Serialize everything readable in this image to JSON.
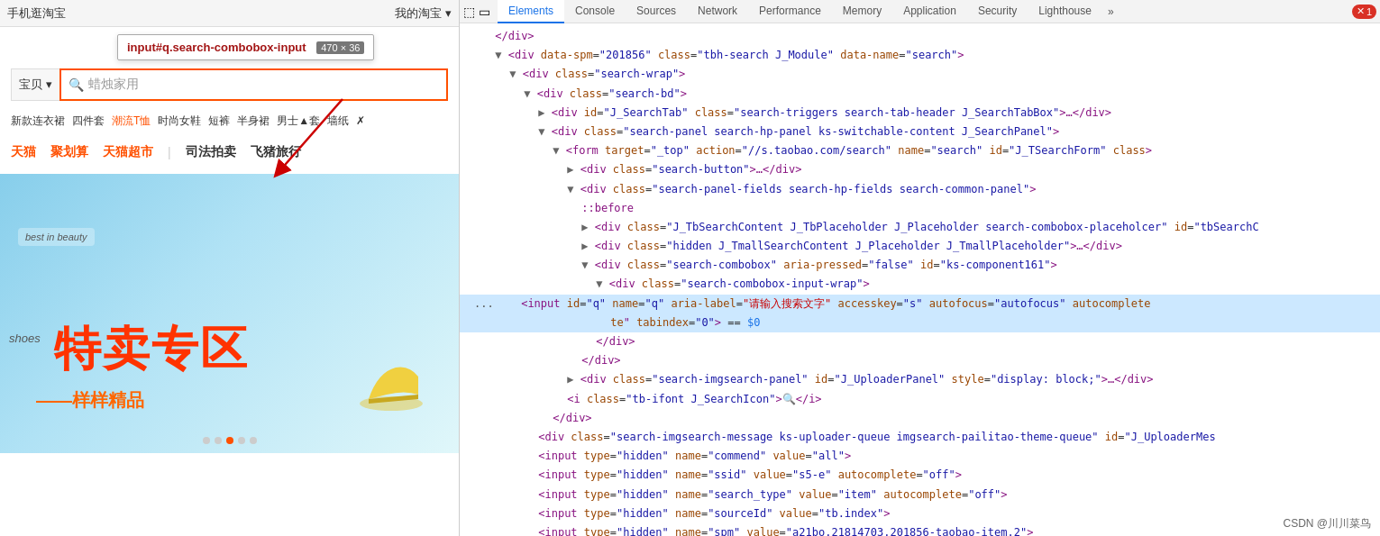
{
  "browser": {
    "top_nav": {
      "items": [
        "手机逛淘宝",
        "我的淘宝 ▾"
      ]
    },
    "tooltip": {
      "element": "input#q.search-combobox-input",
      "size": "470 × 36"
    },
    "search": {
      "category": "宝贝 ▾",
      "placeholder": "蜡烛家用",
      "icon": "🔍"
    },
    "tags": [
      "新款连衣裙",
      "四件套",
      "潮流T恤",
      "时尚女鞋",
      "短裤",
      "半身裙",
      "男士▲套",
      "墙纸",
      "✗"
    ],
    "cat_nav": [
      "天猫",
      "聚划算",
      "天猫超市",
      "|",
      "司法拍卖",
      "飞猪旅行"
    ],
    "banner": {
      "big_text": "特卖专▲",
      "sub_text": "样样精品",
      "best_label": "best in beauty",
      "shoes_label": "shoes"
    }
  },
  "devtools": {
    "tabs": [
      "Elements",
      "Console",
      "Sources",
      "Network",
      "Performance",
      "Memory",
      "Application",
      "Security",
      "Lighthouse"
    ],
    "active_tab": "Elements",
    "tab_icons": [
      "cursor-icon",
      "box-icon"
    ],
    "more_label": "»",
    "error_count": "1",
    "html": {
      "lines": [
        {
          "indent": 4,
          "content": "</div>",
          "type": "tag",
          "highlighted": false
        },
        {
          "indent": 4,
          "content": "<div data-spm=\"201856\" class=\"tbh-search J_Module\" data-name=\"search\">",
          "type": "tag",
          "highlighted": false
        },
        {
          "indent": 5,
          "content": "<div class=\"search-wrap\">",
          "type": "tag",
          "highlighted": false
        },
        {
          "indent": 6,
          "content": "<div class=\"search-bd\">",
          "type": "tag",
          "highlighted": false
        },
        {
          "indent": 7,
          "content": "<div id=\"J_SearchTab\" class=\"search-triggers search-tab-header J_SearchTabBox\">…</div>",
          "type": "tag",
          "highlighted": false
        },
        {
          "indent": 7,
          "content": "<div class=\"search-panel search-hp-panel ks-switchable-content J_SearchPanel\">",
          "type": "tag",
          "highlighted": false
        },
        {
          "indent": 8,
          "content": "<form target=\"_top\" action=\"//s.taobao.com/search\" name=\"search\" id=\"J_TSearchForm\" class>",
          "type": "tag",
          "highlighted": false
        },
        {
          "indent": 9,
          "content": "<div class=\"search-button\">…</div>",
          "type": "tag",
          "highlighted": false
        },
        {
          "indent": 9,
          "content": "<div class=\"search-panel-fields search-hp-fields search-common-panel\">",
          "type": "tag",
          "highlighted": false
        },
        {
          "indent": 10,
          "content": "::before",
          "type": "pseudo",
          "highlighted": false
        },
        {
          "indent": 10,
          "content": "<div class=\"J_TbSearchContent J_TbPlaceholder J_Placeholder search-combobox-placeholcer\" id=\"tbSearchC",
          "type": "tag",
          "highlighted": false
        },
        {
          "indent": 10,
          "content": "<div class=\"hidden J_TmallSearchContent J_Placeholder J_TmallPlaceholder\">…</div>",
          "type": "tag",
          "highlighted": false
        },
        {
          "indent": 10,
          "content": "<div class=\"search-combobox\" aria-pressed=\"false\" id=\"ks-component161\">",
          "type": "tag",
          "highlighted": false
        },
        {
          "indent": 11,
          "content": "<div class=\"search-combobox-input-wrap\">",
          "type": "tag",
          "highlighted": false
        },
        {
          "indent": 12,
          "content": "<input id=\"q\" name=\"q\" aria-label=\"请输入搜索文字\" accesskey=\"s\" autofocus=\"autofocus\" autocomplete",
          "type": "tag",
          "highlighted": true,
          "is_selected": true
        },
        {
          "indent": 12,
          "content": "te\" tabindex=\"0\"> == $0",
          "type": "tag-cont",
          "highlighted": true
        },
        {
          "indent": 11,
          "content": "</div>",
          "type": "tag",
          "highlighted": false
        },
        {
          "indent": 10,
          "content": "</div>",
          "type": "tag",
          "highlighted": false
        },
        {
          "indent": 9,
          "content": "<div class=\"search-imgsearch-panel\" id=\"J_UploaderPanel\" style=\"display: block;\">…</div>",
          "type": "tag",
          "highlighted": false
        },
        {
          "indent": 9,
          "content": "<i class=\"tb-ifont J_SearchIcon\">&#x1f50d;</i>",
          "type": "tag",
          "highlighted": false
        },
        {
          "indent": 8,
          "content": "</div>",
          "type": "tag",
          "highlighted": false
        },
        {
          "indent": 7,
          "content": "<div class=\"search-imgsearch-message ks-uploader-queue imgsearch-pailitao-theme-queue\" id=\"J_UploaderMes",
          "type": "tag",
          "highlighted": false
        },
        {
          "indent": 7,
          "content": "<input type=\"hidden\" name=\"commend\" value=\"all\">",
          "type": "tag",
          "highlighted": false
        },
        {
          "indent": 7,
          "content": "<input type=\"hidden\" name=\"ssid\" value=\"s5-e\" autocomplete=\"off\">",
          "type": "tag",
          "highlighted": false
        },
        {
          "indent": 7,
          "content": "<input type=\"hidden\" name=\"search_type\" value=\"item\" autocomplete=\"off\">",
          "type": "tag",
          "highlighted": false
        },
        {
          "indent": 7,
          "content": "<input type=\"hidden\" name=\"sourceId\" value=\"tb.index\">",
          "type": "tag",
          "highlighted": false
        },
        {
          "indent": 7,
          "content": "<input type=\"hidden\" name=\"spm\" value=\"a21bo.21814703.201856-taobao-item.2\">",
          "type": "tag",
          "highlighted": false
        }
      ]
    },
    "watermark": "CSDN @川川菜鸟"
  }
}
